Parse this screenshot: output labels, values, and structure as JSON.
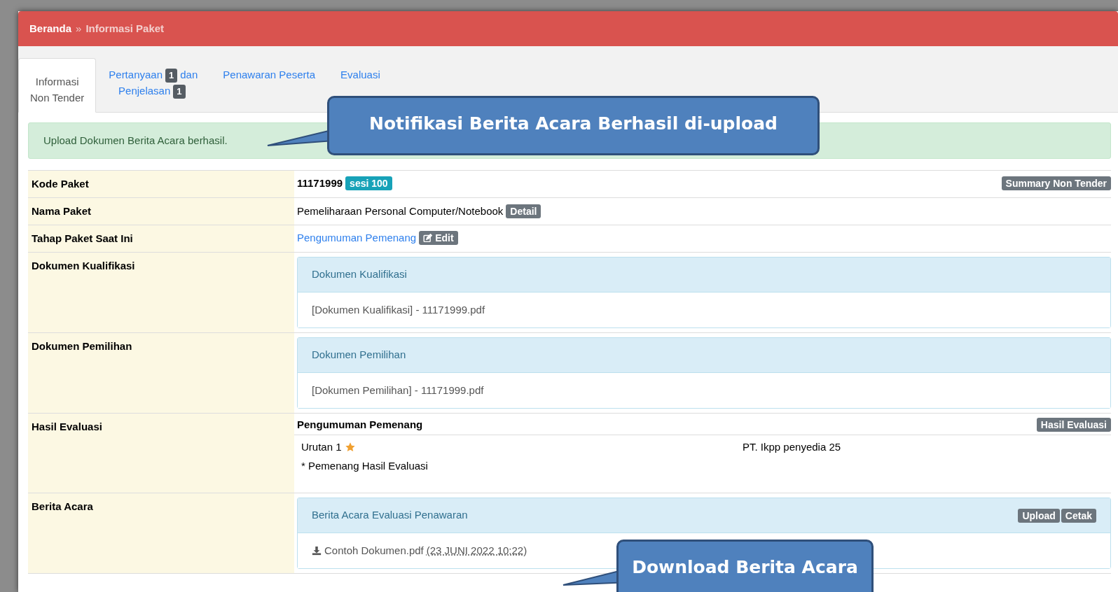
{
  "breadcrumb": [
    {
      "label": "Beranda",
      "selected": false
    },
    {
      "label": "Informasi Paket",
      "selected": true
    }
  ],
  "breadcrumb_separator": "»",
  "tabs": [
    {
      "parts": [
        {
          "kind": "text",
          "text": "Informasi"
        },
        {
          "kind": "break"
        },
        {
          "kind": "text",
          "text": "Non Tender"
        }
      ],
      "selected": true
    },
    {
      "parts": [
        {
          "kind": "text",
          "text": "Pertanyaan"
        },
        {
          "kind": "badge",
          "text": "1"
        },
        {
          "kind": "text",
          "text": "dan"
        },
        {
          "kind": "break"
        },
        {
          "kind": "text",
          "text": "Penjelasan"
        },
        {
          "kind": "badge",
          "text": "1"
        }
      ],
      "selected": false
    },
    {
      "parts": [
        {
          "kind": "text",
          "text": "Penawaran Peserta"
        }
      ],
      "selected": false
    },
    {
      "parts": [
        {
          "kind": "text",
          "text": "Evaluasi"
        }
      ],
      "selected": false
    }
  ],
  "alert": "Upload Dokumen Berita Acara berhasil.",
  "callouts": [
    {
      "text": "Notifikasi Berita Acara Berhasil di-upload"
    },
    {
      "text": "Download Berita Acara"
    }
  ],
  "rows": [
    {
      "kind": "code",
      "label": "Kode Paket",
      "value": "11171999",
      "badge": "sesi 100",
      "action": "Summary Non Tender"
    },
    {
      "kind": "name",
      "label": "Nama Paket",
      "value": "Pemeliharaan Personal Computer/Notebook",
      "action": "Detail"
    },
    {
      "kind": "stage",
      "label": "Tahap Paket Saat Ini",
      "value": "Pengumuman Pemenang",
      "action": "Edit"
    },
    {
      "kind": "panel",
      "label": "Dokumen Kualifikasi",
      "title": "Dokumen Kualifikasi",
      "file": "[Dokumen Kualifikasi] - 11171999.pdf"
    },
    {
      "kind": "panel",
      "label": "Dokumen Pemilihan",
      "title": "Dokumen Pemilihan",
      "file": "[Dokumen Pemilihan] - 11171999.pdf"
    },
    {
      "kind": "evaluation",
      "label": "Hasil Evaluasi",
      "title": "Pengumuman Pemenang",
      "action": "Hasil Evaluasi",
      "rank": "Urutan 1",
      "winner": true,
      "company": "PT. Ikpp penyedia 25",
      "note": "* Pemenang Hasil Evaluasi"
    },
    {
      "kind": "minutes",
      "label": "Berita Acara",
      "title": "Berita Acara Evaluasi Penawaran",
      "actions": [
        "Upload",
        "Cetak"
      ],
      "file": "Contoh Dokumen.pdf",
      "date": "(23 JUNI 2022 10:22)"
    }
  ]
}
